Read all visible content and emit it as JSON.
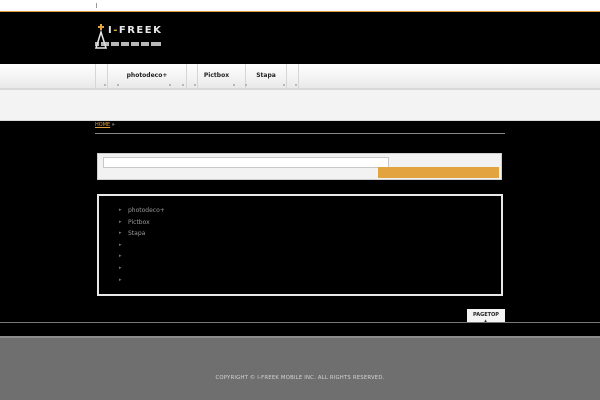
{
  "logo": {
    "brand_pre": "I",
    "brand_dot": "-",
    "brand_post": "FREEK"
  },
  "nav": {
    "items": [
      {
        "label": "photodeco+"
      },
      {
        "label": "Pictbox"
      },
      {
        "label": "Stapa"
      }
    ]
  },
  "breadcrumb": {
    "home": "HOME",
    "separator": "»"
  },
  "search": {
    "value": "",
    "button_label": ""
  },
  "list": {
    "items": [
      {
        "label": "photodeco+"
      },
      {
        "label": "Pictbox"
      },
      {
        "label": "Stapa"
      },
      {
        "label": ""
      },
      {
        "label": ""
      },
      {
        "label": ""
      },
      {
        "label": ""
      }
    ]
  },
  "pagetop": {
    "label": "PAGETOP",
    "arrow": "▲"
  },
  "footer": {
    "copyright": "COPYRIGHT © I-FREEK MOBILE INC. ALL RIGHTS RESERVED."
  },
  "colors": {
    "accent": "#e3a33f",
    "background": "#000000",
    "footer": "#6f6f6f"
  }
}
